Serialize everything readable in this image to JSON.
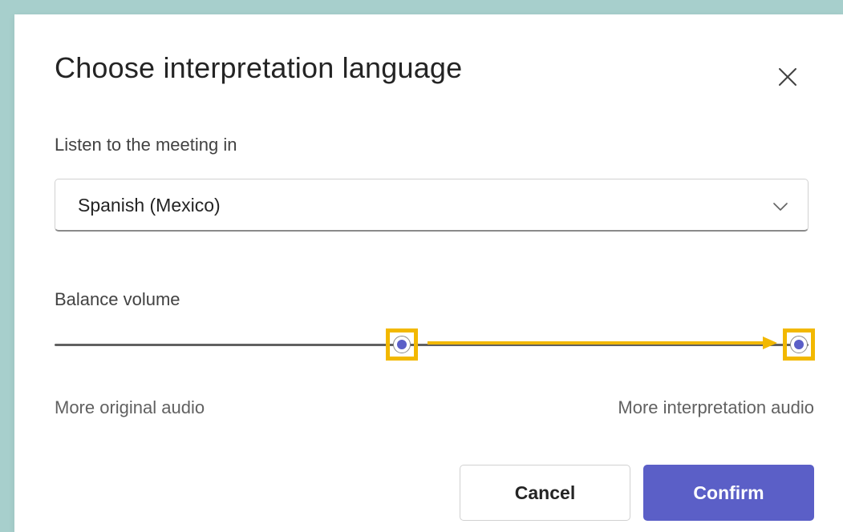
{
  "dialog": {
    "title": "Choose interpretation language",
    "close_icon": "close-icon"
  },
  "language": {
    "label": "Listen to the meeting in",
    "selected": "Spanish (Mexico)",
    "chevron_icon": "chevron-down-icon"
  },
  "balance": {
    "label": "Balance volume",
    "current_value": 0.46,
    "target_value": 1.0,
    "min_label": "More original audio",
    "max_label": "More interpretation audio"
  },
  "buttons": {
    "cancel_label": "Cancel",
    "confirm_label": "Confirm"
  },
  "colors": {
    "accent": "#5b5fc7",
    "highlight": "#f2b800",
    "background": "#a7cfcc"
  }
}
